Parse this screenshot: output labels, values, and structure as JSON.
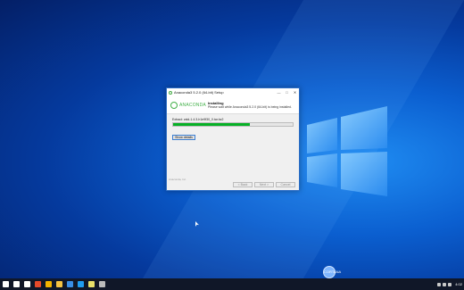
{
  "window": {
    "title": "Anaconda3 5.2.0 (64-bit) Setup",
    "minimize_label": "—",
    "maximize_label": "□",
    "close_label": "✕"
  },
  "header": {
    "brand": "ANACONDA",
    "title": "Installing",
    "subtitle": "Please wait while Anaconda3 5.2.0 (64-bit) is being installed."
  },
  "body": {
    "status": "Extract: zstd-1.4.3-h1e9f30_0.tar.bz2",
    "progress": 0.64,
    "show_details_label": "Show details"
  },
  "footer": {
    "vendor": "Anaconda, Inc.",
    "back_label": "< Back",
    "next_label": "Next >",
    "cancel_label": "Cancel"
  },
  "taskbar": {
    "items": [
      {
        "name": "start-icon",
        "color": "#ffffff"
      },
      {
        "name": "search-icon",
        "color": "#ffffff"
      },
      {
        "name": "task-view-icon",
        "color": "#ffffff"
      },
      {
        "name": "app-icon",
        "color": "#e84a2a"
      },
      {
        "name": "chrome-icon",
        "color": "#f4b400"
      },
      {
        "name": "folder-icon",
        "color": "#f5c242"
      },
      {
        "name": "settings-icon",
        "color": "#3a8ee6"
      },
      {
        "name": "vscode-icon",
        "color": "#1f9cf0"
      },
      {
        "name": "notepad-icon",
        "color": "#e8e06a"
      },
      {
        "name": "terminal-icon",
        "color": "#bbbbbb"
      }
    ],
    "clock": "4:02"
  },
  "cortana_label": "CORTANA"
}
